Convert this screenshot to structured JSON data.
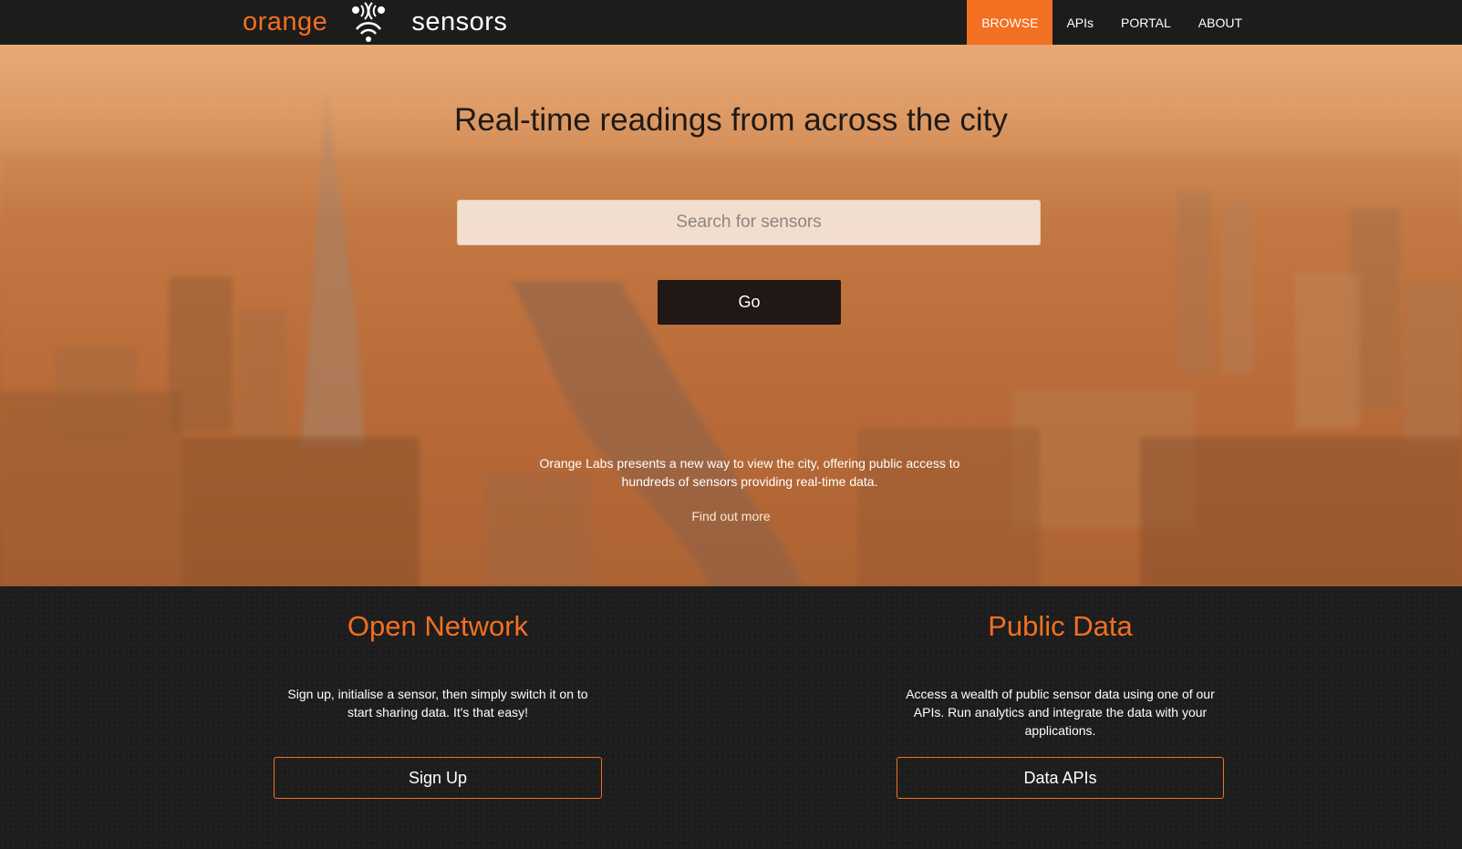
{
  "nav": {
    "brand_orange": "orange",
    "brand_sensors": "sensors",
    "links": [
      {
        "label": "BROWSE",
        "active": true
      },
      {
        "label": "APIs",
        "active": false
      },
      {
        "label": "PORTAL",
        "active": false
      },
      {
        "label": "ABOUT",
        "active": false
      }
    ]
  },
  "hero": {
    "title": "Real-time readings from across the city",
    "search_placeholder": "Search for sensors",
    "go_label": "Go",
    "description": "Orange Labs presents a new way to view the city, offering public access to hundreds of sensors providing real-time data.",
    "find_more": "Find out more"
  },
  "features": [
    {
      "title": "Open Network",
      "text": "Sign up, initialise a sensor, then simply switch it on to start sharing data. It's that easy!",
      "button": "Sign Up"
    },
    {
      "title": "Public Data",
      "text": "Access a wealth of public sensor data using one of our APIs. Run analytics and integrate the data with your applications.",
      "button": "Data APIs"
    }
  ],
  "colors": {
    "accent": "#f36f21",
    "navbar_bg": "#1c1c1c",
    "features_bg": "#1d1d1d"
  },
  "icons": {
    "brand_logo": "sensor-signal-icon"
  }
}
